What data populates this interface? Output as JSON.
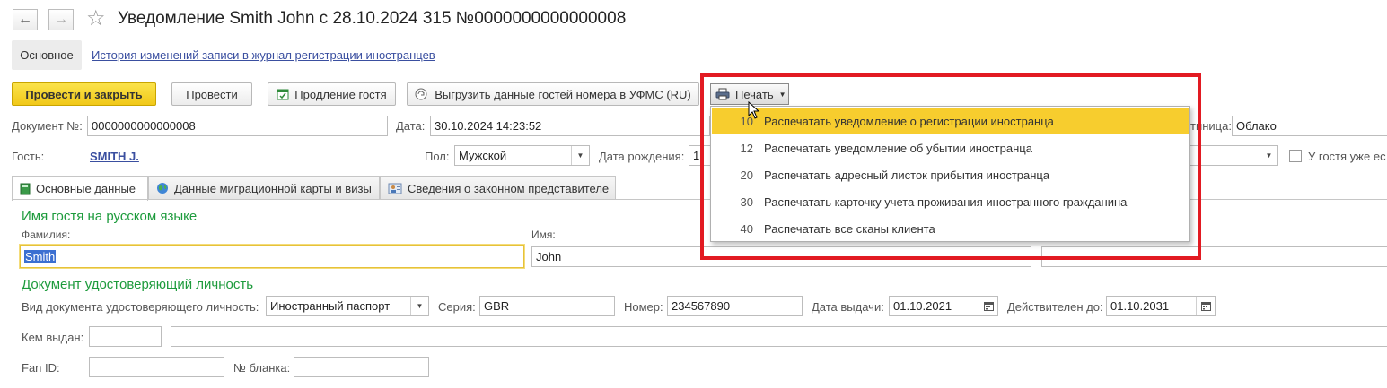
{
  "window": {
    "title": "Уведомление Smith John с 28.10.2024 315 №0000000000000008"
  },
  "nav": {
    "main_tab": "Основное",
    "history_link": "История изменений записи в журнал регистрации иностранцев"
  },
  "toolbar": {
    "post_close_label": "Провести и закрыть",
    "post_label": "Провести",
    "extend_label": "Продление гостя",
    "export_label": "Выгрузить данные гостей номера в УФМС (RU)",
    "print_label": "Печать"
  },
  "print_menu": {
    "items": [
      {
        "num": "10",
        "label": "Распечатать уведомление о регистрации иностранца"
      },
      {
        "num": "12",
        "label": "Распечатать уведомление об убытии иностранца"
      },
      {
        "num": "20",
        "label": "Распечатать адресный листок прибытия иностранца"
      },
      {
        "num": "30",
        "label": "Распечатать карточку учета проживания иностранного гражданина"
      },
      {
        "num": "40",
        "label": "Распечатать все сканы клиента"
      }
    ],
    "highlighted_index": 0
  },
  "header": {
    "doc_number_label": "Документ №:",
    "doc_number": "0000000000000008",
    "date_label": "Дата:",
    "date": "30.10.2024 14:23:52",
    "hotel_label_tail": "тиница:",
    "hotel": "Облако",
    "guest_label": "Гость:",
    "guest": "SMITH J.",
    "gender_label": "Пол:",
    "gender": "Мужской",
    "birth_label": "Дата рождения:",
    "birth_partial": "1",
    "already_label": "У гостя уже ес"
  },
  "tabs": [
    {
      "label": "Основные данные",
      "icon": "book-icon"
    },
    {
      "label": "Данные миграционной карты и визы",
      "icon": "globe-icon"
    },
    {
      "label": "Сведения о законном представителе",
      "icon": "person-icon"
    }
  ],
  "name_section": {
    "title": "Имя гостя на русском языке",
    "surname_label": "Фамилия:",
    "surname": "Smith",
    "name_label": "Имя:",
    "name": "John"
  },
  "id_section": {
    "title": "Документ удостоверяющий личность",
    "doc_type_label": "Вид документа удостоверяющего личность:",
    "doc_type": "Иностранный паспорт",
    "series_label": "Серия:",
    "series": "GBR",
    "number_label": "Номер:",
    "number": "234567890",
    "issue_date_label": "Дата выдачи:",
    "issue_date": "01.10.2021",
    "valid_until_label": "Действителен до:",
    "valid_until": "01.10.2031",
    "issued_by_label": "Кем выдан:",
    "issued_by_code": "",
    "issued_by": "",
    "fan_id_label": "Fan ID:",
    "fan_id": "",
    "blank_no_label": "№ бланка:",
    "blank_no": ""
  },
  "colors": {
    "accent_yellow": "#f7cd2e",
    "section_green": "#1d9b3c",
    "link_blue": "#3a4fa0",
    "annotation_red": "#e21a22"
  }
}
